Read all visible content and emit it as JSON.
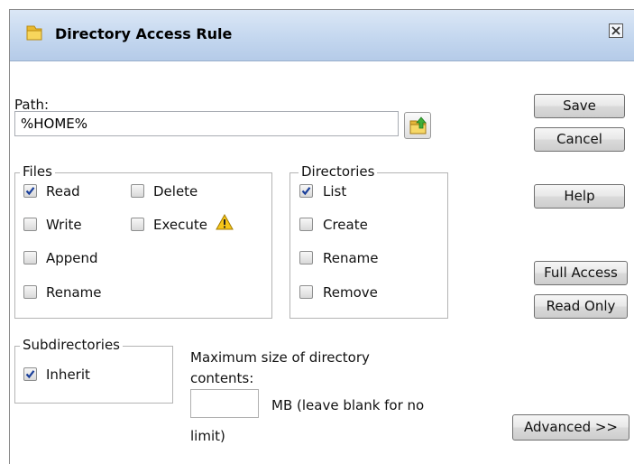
{
  "window": {
    "title": "Directory Access Rule"
  },
  "path": {
    "label": "Path:",
    "value": "%HOME%"
  },
  "files": {
    "legend": "Files",
    "read": {
      "label": "Read",
      "checked": true
    },
    "write": {
      "label": "Write",
      "checked": false
    },
    "append": {
      "label": "Append",
      "checked": false
    },
    "rename": {
      "label": "Rename",
      "checked": false
    },
    "delete": {
      "label": "Delete",
      "checked": false
    },
    "execute": {
      "label": "Execute",
      "checked": false
    }
  },
  "directories": {
    "legend": "Directories",
    "list": {
      "label": "List",
      "checked": true
    },
    "create": {
      "label": "Create",
      "checked": false
    },
    "rename": {
      "label": "Rename",
      "checked": false
    },
    "remove": {
      "label": "Remove",
      "checked": false
    }
  },
  "subdirectories": {
    "legend": "Subdirectories",
    "inherit": {
      "label": "Inherit",
      "checked": true
    }
  },
  "max_size": {
    "label_line1": "Maximum size of directory",
    "label_line2": "contents:",
    "value": "",
    "unit_line1": "MB (leave blank for no",
    "unit_line2": "limit)"
  },
  "buttons": {
    "save": "Save",
    "cancel": "Cancel",
    "help": "Help",
    "full_access": "Full Access",
    "read_only": "Read Only",
    "advanced": "Advanced >>"
  },
  "icons": {
    "title": "folder-icon",
    "close": "close-icon",
    "browse": "browse-folder-icon",
    "execute_warning": "warning-icon"
  }
}
